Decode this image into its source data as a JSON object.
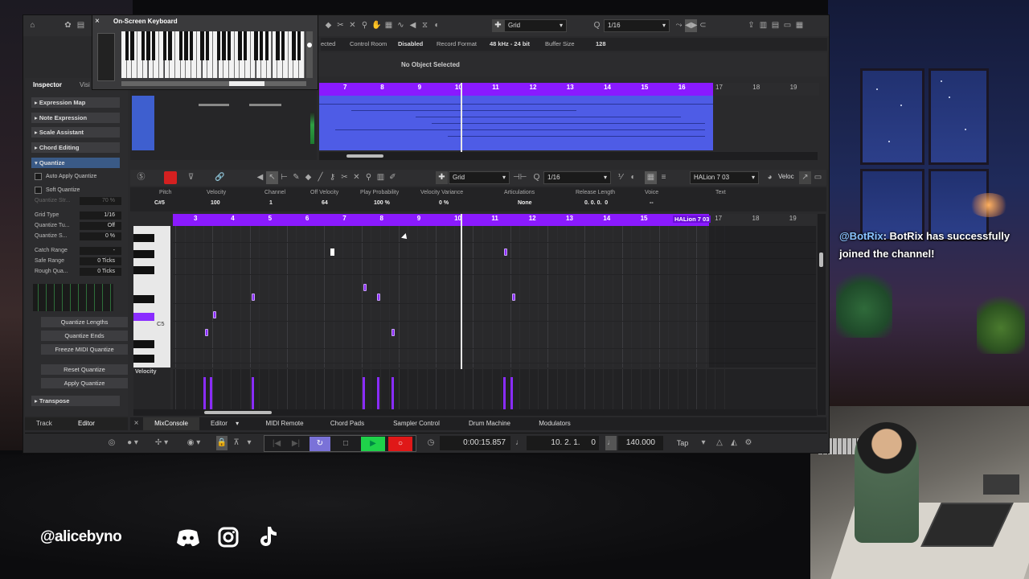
{
  "overlay": {
    "handle": "@alicebyno",
    "chat": {
      "user": "@BotRix",
      "message": ": BotRix has successfully joined the channel!"
    },
    "icons": [
      "discord-icon",
      "instagram-icon",
      "tiktok-icon"
    ]
  },
  "keyboard": {
    "title": "On-Screen Keyboard",
    "close": "×"
  },
  "toolbar": {
    "grid_mode": "Grid",
    "quantize": "1/16"
  },
  "status_bar": {
    "selected_suffix": "ected",
    "control_room": "Control Room",
    "disabled": "Disabled",
    "record_format": "Record Format",
    "format_value": "48 kHz - 24 bit",
    "buffer_size": "Buffer Size",
    "buffer_value": "128"
  },
  "info_line": "No Object Selected",
  "inspector": {
    "tabs": [
      "Inspector",
      "Visi"
    ],
    "sections": [
      "Expression Map",
      "Note Expression",
      "Scale Assistant",
      "Chord Editing",
      "Quantize"
    ],
    "checkboxes": [
      "Auto Apply Quantize",
      "Soft Quantize"
    ],
    "faded_row": {
      "label": "Quantize Str...",
      "value": "70 %"
    },
    "rows": [
      {
        "label": "Grid Type",
        "value": "1/16"
      },
      {
        "label": "Quantize Tu...",
        "value": "Off"
      },
      {
        "label": "Quantize S...",
        "value": "0 %"
      },
      {
        "label": "Catch Range",
        "value": "-"
      },
      {
        "label": "Safe Range",
        "value": "0 Ticks"
      },
      {
        "label": "Rough Qua...",
        "value": "0 Ticks"
      }
    ],
    "buttons": [
      "Quantize Lengths",
      "Quantize Ends",
      "Freeze MIDI Quantize",
      "Reset Quantize",
      "Apply Quantize"
    ],
    "transpose": "Transpose",
    "bottom_tabs": [
      "Track",
      "Editor"
    ]
  },
  "editor_toolbar": {
    "grid_mode": "Grid",
    "quantize": "1/16",
    "instrument": "HALion 7 03",
    "lane": "Veloc"
  },
  "info_bar": {
    "headers": [
      "Pitch",
      "Velocity",
      "Channel",
      "Off Velocity",
      "Play Probability",
      "Velocity Variance",
      "Articulations",
      "Release Length",
      "Voice",
      "Text"
    ],
    "values": [
      "C#5",
      "100",
      "1",
      "64",
      "100 %",
      "0 %",
      "None",
      "0. 0. 0.  0",
      "--",
      ""
    ]
  },
  "upper_ruler": [
    "7",
    "8",
    "9",
    "10",
    "11",
    "12",
    "13",
    "14",
    "15",
    "16",
    "17",
    "18",
    "19"
  ],
  "editor_ruler": [
    "3",
    "4",
    "5",
    "6",
    "7",
    "8",
    "9",
    "10",
    "11",
    "12",
    "13",
    "14",
    "15",
    "17",
    "18",
    "19"
  ],
  "event_label": "HALion 7 03",
  "keys": {
    "c5": "C5"
  },
  "velocity_label": "Velocity",
  "lower_zone_tabs": [
    "MixConsole",
    "Editor",
    "MIDI Remote",
    "Chord Pads",
    "Sampler Control",
    "Drum Machine",
    "Modulators"
  ],
  "transport": {
    "time": "0:00:15.857",
    "bars": "10. 2. 1.     0",
    "tempo": "140.000",
    "tap": "Tap"
  },
  "colors": {
    "accent": "#8a1aff",
    "note": "#8a2cff",
    "play": "#1fd14a",
    "record": "#e01818"
  }
}
